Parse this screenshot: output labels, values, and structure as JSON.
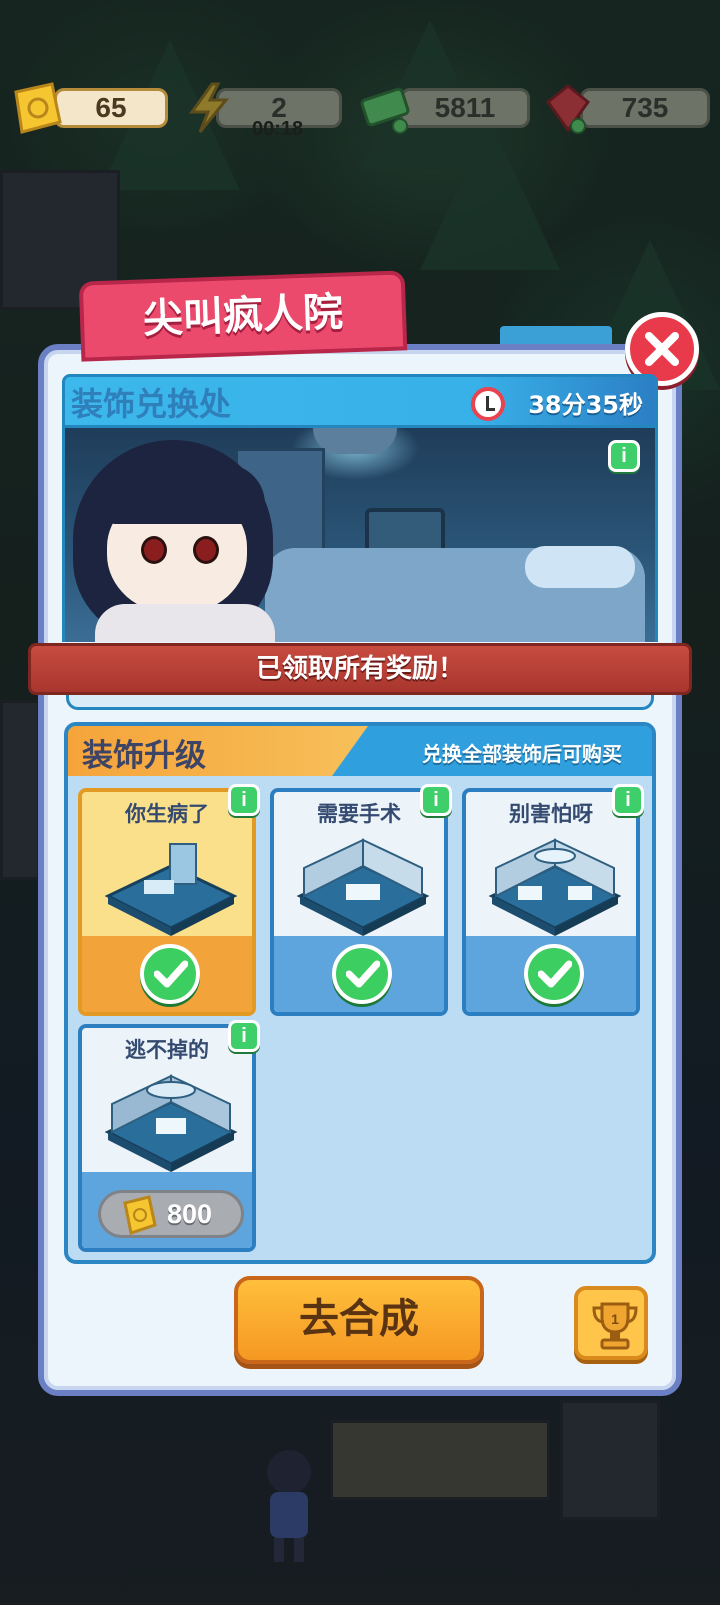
{
  "resources": {
    "tickets": "65",
    "energy": "2",
    "energy_timer": "00:18",
    "cash": "5811",
    "gems": "735"
  },
  "panel": {
    "title": "尖叫疯人院",
    "exchange_title": "装饰兑换处",
    "exchange_countdown": "38分35秒",
    "ribbon_text": "已领取所有奖励！",
    "upgrade_title": "装饰升级",
    "upgrade_note": "兑换全部装饰后可购买",
    "go_button": "去合成",
    "trophy_rank": "1"
  },
  "cards": [
    {
      "name": "你生病了",
      "state": "owned"
    },
    {
      "name": "需要手术",
      "state": "owned"
    },
    {
      "name": "别害怕呀",
      "state": "owned"
    },
    {
      "name": "逃不掉的",
      "state": "locked",
      "price": "800"
    }
  ],
  "icons": {
    "info": "i",
    "close": "close-icon",
    "check": "check-icon"
  },
  "colors": {
    "title_tab": "#ec4a6c",
    "panel_border": "#6a7fc4",
    "ribbon": "#c84b3f",
    "go_button": "#f59822",
    "check": "#3dce62"
  }
}
